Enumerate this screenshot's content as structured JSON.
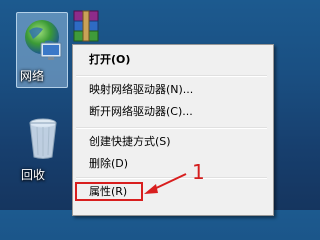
{
  "desktop": {
    "icons": [
      {
        "label": "网络",
        "icon": "network-globe-icon"
      },
      {
        "label": "",
        "icon": "winrar-icon"
      },
      {
        "label": "回收",
        "icon": "recycle-bin-icon"
      }
    ]
  },
  "context_menu": {
    "items": [
      {
        "label": "打开(O)",
        "bold": true
      },
      {
        "label": "映射网络驱动器(N)..."
      },
      {
        "label": "断开网络驱动器(C)..."
      },
      {
        "label": "创建快捷方式(S)"
      },
      {
        "label": "删除(D)"
      },
      {
        "label": "属性(R)"
      }
    ]
  },
  "annotation": {
    "number": "1",
    "color": "#d81e1e"
  }
}
